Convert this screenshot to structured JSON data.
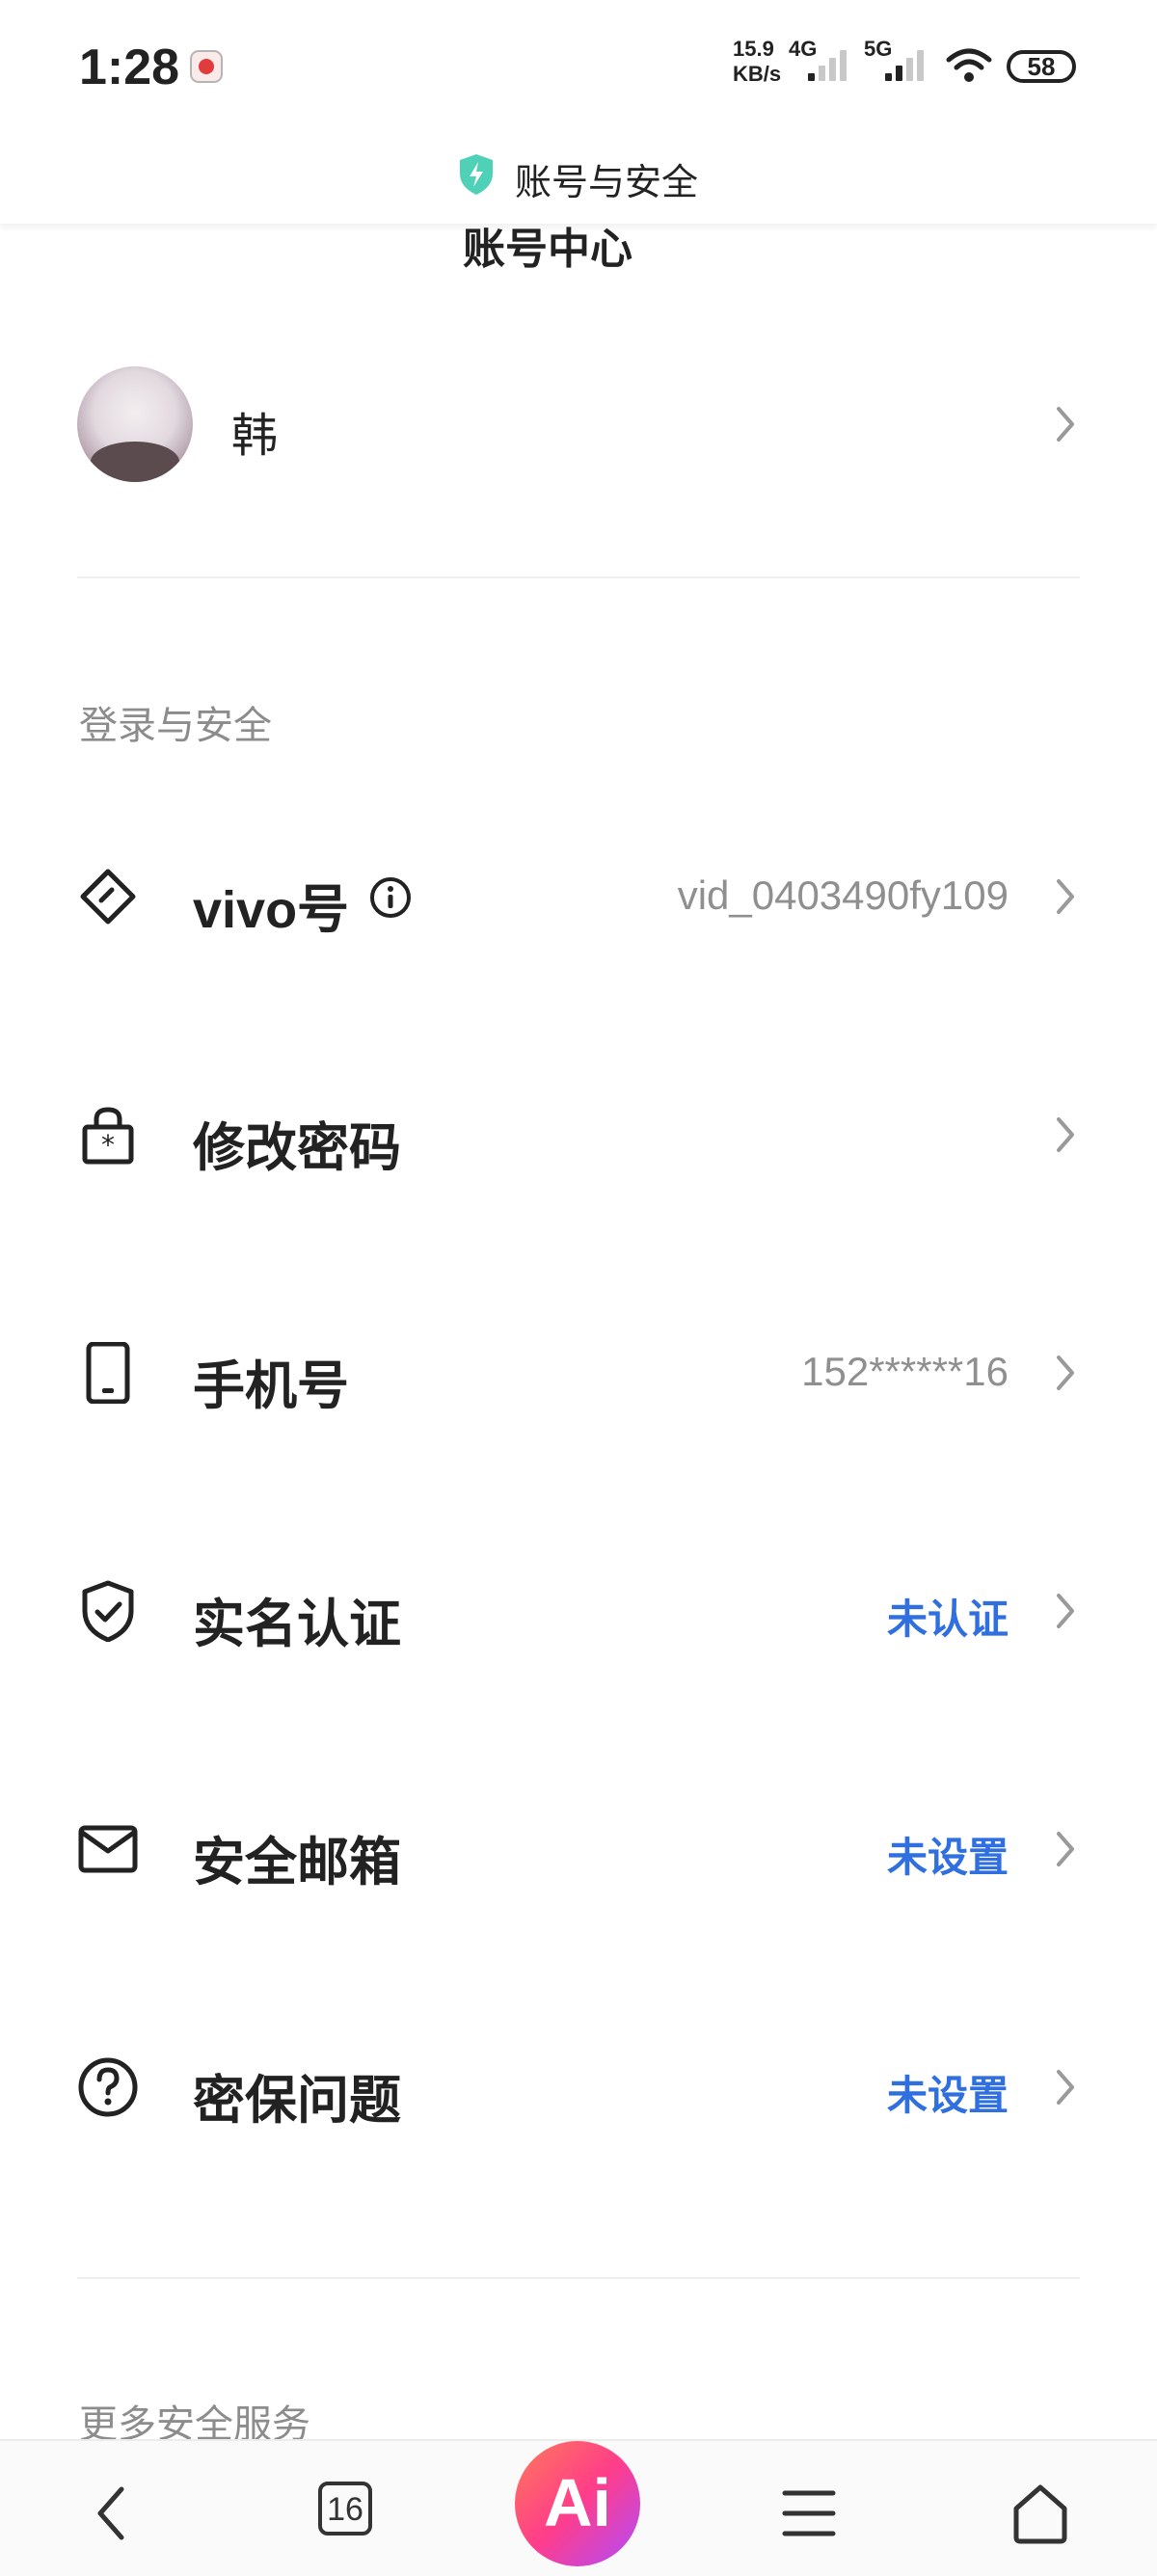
{
  "status_bar": {
    "time": "1:28",
    "net_speed_value": "15.9",
    "net_speed_unit": "KB/s",
    "sim1_label": "4G",
    "sim2_label": "5G",
    "battery": "58"
  },
  "header": {
    "title": "账号与安全",
    "partial_heading": "账号中心"
  },
  "profile": {
    "name": "韩"
  },
  "sections": {
    "login_security": "登录与安全",
    "more_services": "更多安全服务"
  },
  "rows": [
    {
      "label": "vivo号",
      "value": "vid_0403490fy109",
      "icon": "vivo-id-icon"
    },
    {
      "label": "修改密码",
      "value": "",
      "icon": "lock-icon"
    },
    {
      "label": "手机号",
      "value": "152******16",
      "icon": "phone-icon"
    },
    {
      "label": "实名认证",
      "value": "未认证",
      "icon": "shield-check-icon"
    },
    {
      "label": "安全邮箱",
      "value": "未设置",
      "icon": "mail-icon"
    },
    {
      "label": "密保问题",
      "value": "未设置",
      "icon": "question-icon"
    }
  ],
  "bottom_nav": {
    "tab_count": "16",
    "ai_label": "Ai"
  },
  "colors": {
    "accent_blue": "#2f6fdf",
    "muted_text": "#8f8f8f",
    "shield_teal": "#4fd1b8"
  }
}
